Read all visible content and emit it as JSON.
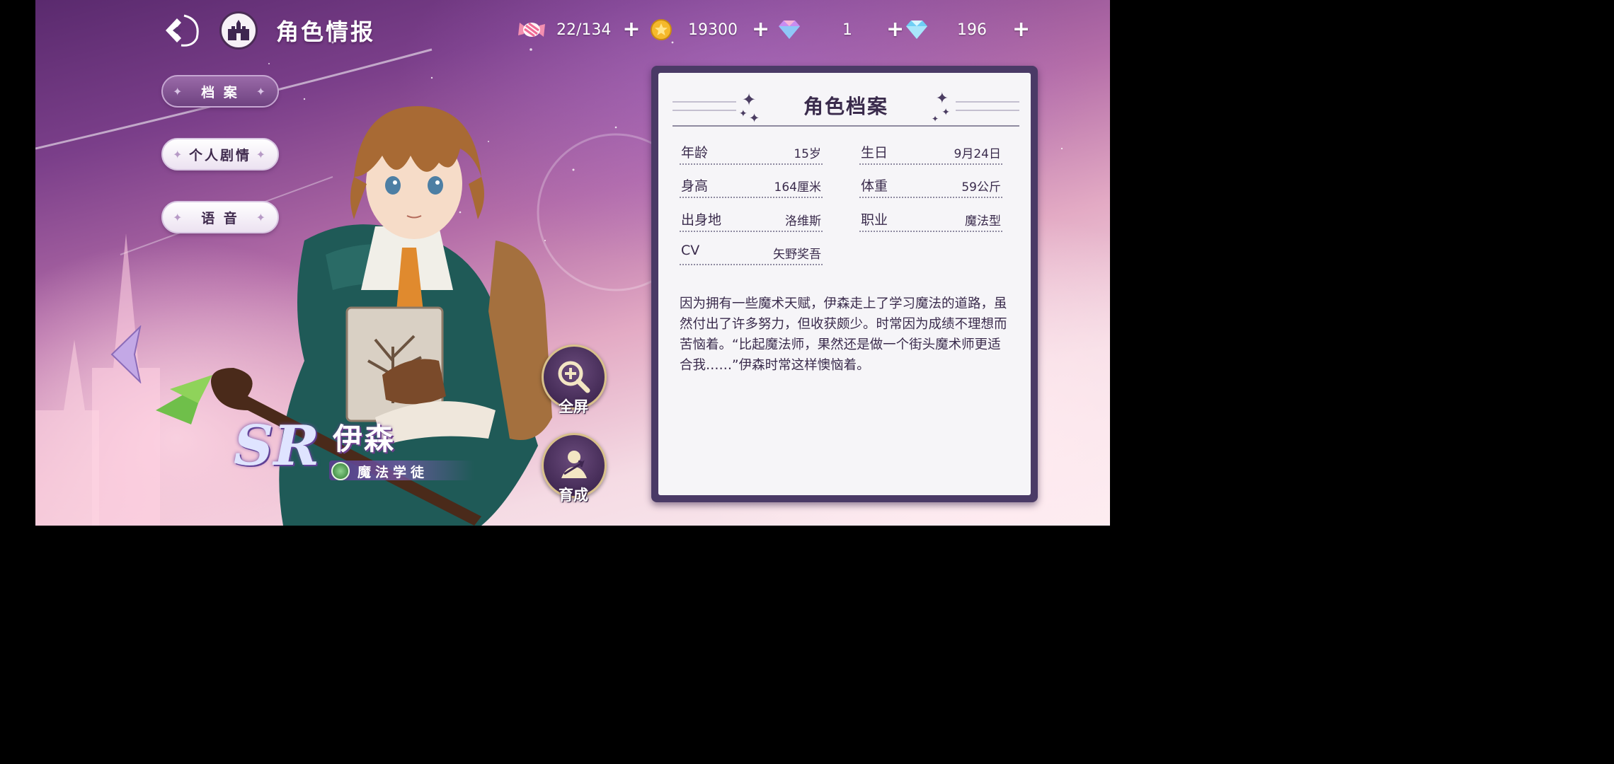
{
  "header": {
    "title": "角色情报"
  },
  "resources": [
    {
      "icon": "candy-icon",
      "value": "22/134"
    },
    {
      "icon": "gold-coin-icon",
      "value": "19300"
    },
    {
      "icon": "rainbow-gem-icon",
      "value": "1"
    },
    {
      "icon": "diamond-icon",
      "value": "196"
    }
  ],
  "resource_plus": "+",
  "side_menu": {
    "items": [
      {
        "label": "档 案",
        "active": true
      },
      {
        "label": "个人剧情",
        "active": false
      },
      {
        "label": "语 音",
        "active": false
      }
    ]
  },
  "character": {
    "rarity": "SR",
    "name": "伊森",
    "title": "魔法学徒"
  },
  "actions": {
    "fullscreen_label": "全屏",
    "develop_label": "育成"
  },
  "profile": {
    "title": "角色档案",
    "fields": [
      {
        "key": "年龄",
        "value": "15岁"
      },
      {
        "key": "生日",
        "value": "9月24日"
      },
      {
        "key": "身高",
        "value": "164厘米"
      },
      {
        "key": "体重",
        "value": "59公斤"
      },
      {
        "key": "出身地",
        "value": "洛维斯"
      },
      {
        "key": "职业",
        "value": "魔法型"
      },
      {
        "key": "CV",
        "value": "矢野奖吾"
      }
    ],
    "description": "因为拥有一些魔术天赋，伊森走上了学习魔法的道路，虽然付出了许多努力，但收获颇少。时常因为成绩不理想而苦恼着。“比起魔法师，果然还是做一个街头魔术师更适合我……”伊森时常这样懊恼着。"
  },
  "colors": {
    "panel_border": "#4a3a66",
    "panel_bg": "#f6f5f8",
    "active_tab": "#7b4d8f",
    "nav_arrow": "#c3a8e6"
  }
}
